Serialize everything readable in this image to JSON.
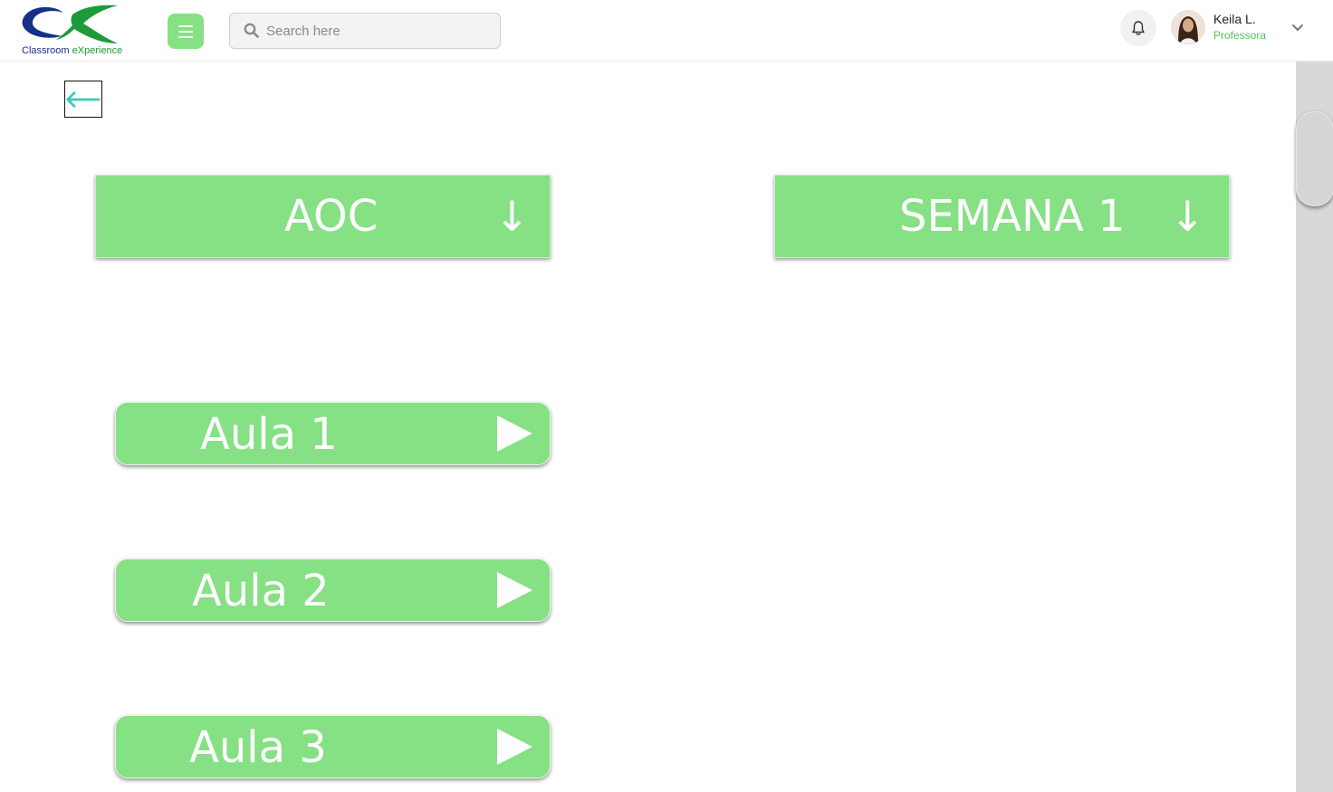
{
  "header": {
    "logo_text_1": "Classroom",
    "logo_text_2": "eXperience",
    "search_placeholder": "Search here",
    "user_name": "Keila L.",
    "user_role": "Professora"
  },
  "dropdowns": [
    {
      "label": "AOC"
    },
    {
      "label": "SEMANA 1"
    }
  ],
  "lessons": [
    {
      "label": "Aula 1"
    },
    {
      "label": "Aula 2"
    },
    {
      "label": "Aula 3"
    }
  ],
  "icons": {
    "menu": "hamburger-icon",
    "search": "search-icon",
    "bell": "bell-icon",
    "chevron": "chevron-down-icon",
    "back": "arrow-left-icon",
    "dropdown_arrow": "arrow-down-icon",
    "play": "play-icon"
  },
  "colors": {
    "accent": "#86e084",
    "role_text": "#55c35a",
    "logo_blue": "#16308a",
    "logo_green": "#1d9a3a"
  }
}
